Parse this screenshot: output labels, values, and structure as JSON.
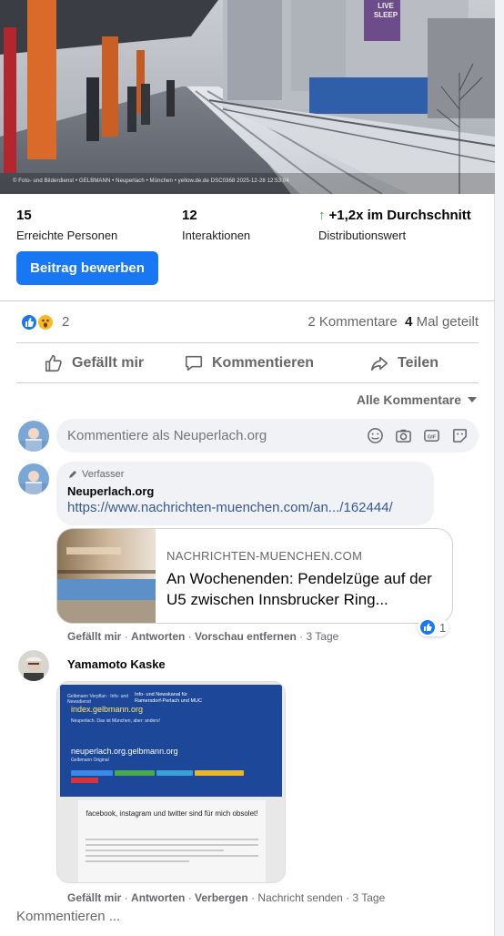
{
  "hero": {
    "caption": "© Foto- und Bilderdienst • GELBMANN • Neuperlach • München • yellow.de.de    DSC0368 2025-12-28 12:53:04",
    "sign_text": "LIVE SLEEP"
  },
  "stats": [
    {
      "value": "15",
      "label": "Erreichte Personen"
    },
    {
      "value": "12",
      "label": "Interaktionen"
    },
    {
      "value": "+1,2x im Durchschnitt",
      "label": "Distributionswert"
    }
  ],
  "promote_button": "Beitrag bewerben",
  "reactions": {
    "count": "2",
    "comments": "2 Kommentare",
    "shares_count": "4",
    "shares_label": "Mal geteilt"
  },
  "actions": {
    "like": "Gefällt mir",
    "comment": "Kommentieren",
    "share": "Teilen"
  },
  "filter_label": "Alle Kommentare",
  "composer": {
    "placeholder": "Kommentiere als Neuperlach.org"
  },
  "comments": [
    {
      "badge": "Verfasser",
      "author": "Neuperlach.org",
      "link": "https://www.nachrichten-muenchen.com/an.../162444/",
      "preview": {
        "domain": "NACHRICHTEN-MUENCHEN.COM",
        "title": "An Wochenenden: Pendelzüge auf der U5 zwischen Innsbrucker Ring..."
      },
      "actions": [
        "Gefällt mir",
        "Antworten",
        "Vorschau entfernen"
      ],
      "time": "3 Tage",
      "like_count": "1"
    },
    {
      "author": "Yamamoto Kaske",
      "image": {
        "header_small": "Gelbmann Verpflan · Info- und Newsdienst",
        "title": "Info- und Newskanal für Ramersdorf-Perlach und MUC",
        "site1": "index.gelbmann.org",
        "tagline": "Neuperlach. Das ist München, aber: anders!",
        "site2": "neuperlach.org.gelbmann.org",
        "sub2": "Gelbmann Original",
        "heading": "facebook, instagram und twitter sind für mich obsolet!"
      },
      "actions": [
        "Gefällt mir",
        "Antworten",
        "Verbergen"
      ],
      "extra_action": "Nachricht senden",
      "time": "3 Tage"
    }
  ],
  "write_comment": "Kommentieren ..."
}
